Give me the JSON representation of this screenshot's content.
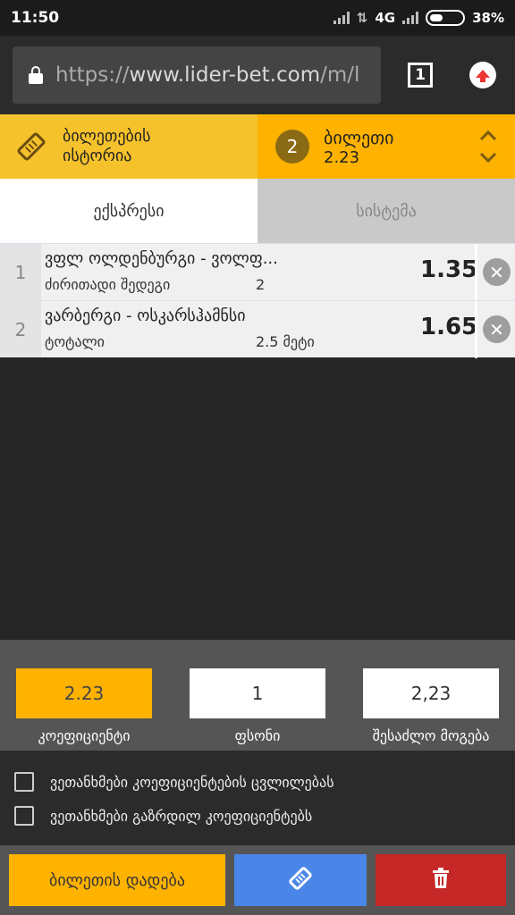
{
  "status_bar": {
    "time": "11:50",
    "network": "4G",
    "battery": "38%"
  },
  "browser": {
    "url_scheme": "https://",
    "url_host": "www.lider-bet.com",
    "url_rest": "/m/l",
    "tab_count": "1"
  },
  "header": {
    "history_line1": "ბილეთების",
    "history_line2": "ისტორია",
    "bet_count": "2",
    "bet_title": "ბილეთი",
    "bet_odds": "2.23"
  },
  "tabs": {
    "express": "ექსპრესი",
    "system": "სისტემა"
  },
  "bets": [
    {
      "index": "1",
      "match": "ვფლ ოლდენბურგი - ვოლფ...",
      "market": "ძირითადი შედეგი",
      "pick": "2",
      "odds": "1.35"
    },
    {
      "index": "2",
      "match": "ვარბერგი - ოსკარსჰამნსი",
      "market": "ტოტალი",
      "pick": "2.5 მეტი",
      "odds": "1.65"
    }
  ],
  "summary": {
    "coefficient": "2.23",
    "coefficient_label": "კოეფიციენტი",
    "stake": "1",
    "stake_label": "ფსონი",
    "possible_win": "2,23",
    "possible_win_label": "შესაძლო მოგება"
  },
  "options": {
    "agree_changes": "ვეთანხმები კოეფიციენტების ცვლილებას",
    "agree_increased": "ვეთანხმები გაზრდილ კოეფიციენტებს"
  },
  "actions": {
    "place_bet": "ბილეთის დადება"
  },
  "colors": {
    "accent": "#ffb300",
    "blue": "#4a86e8",
    "red": "#c62828"
  }
}
